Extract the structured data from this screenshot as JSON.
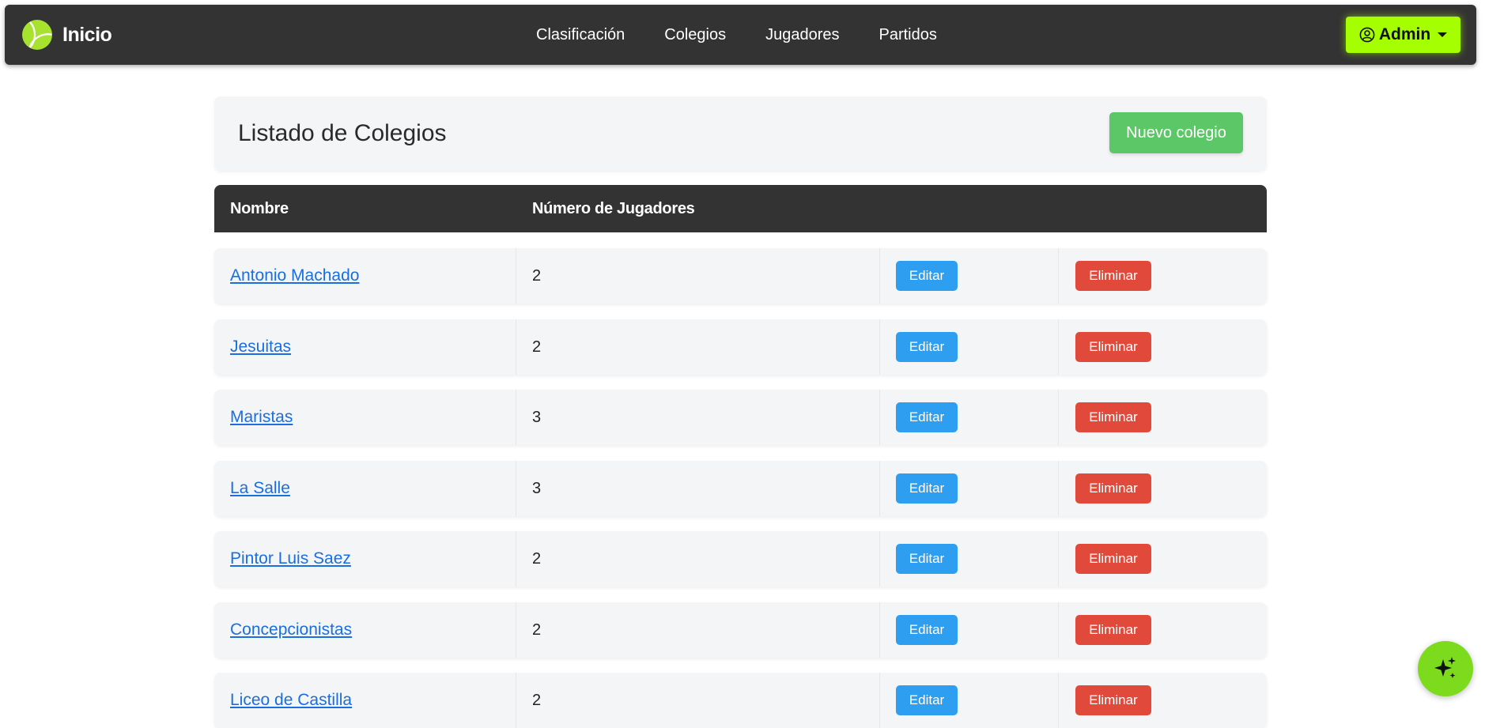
{
  "navbar": {
    "brand": "Inicio",
    "links": [
      "Clasificación",
      "Colegios",
      "Jugadores",
      "Partidos"
    ],
    "user_menu": {
      "label": "Admin",
      "icon": "user-circle-icon"
    }
  },
  "header": {
    "title": "Listado de Colegios",
    "new_button": "Nuevo colegio"
  },
  "table": {
    "columns": [
      "Nombre",
      "Número de Jugadores"
    ],
    "rows": [
      {
        "name": "Antonio Machado",
        "players": "2",
        "edit": "Editar",
        "delete": "Eliminar"
      },
      {
        "name": "Jesuitas",
        "players": "2",
        "edit": "Editar",
        "delete": "Eliminar"
      },
      {
        "name": "Maristas",
        "players": "3",
        "edit": "Editar",
        "delete": "Eliminar"
      },
      {
        "name": "La Salle",
        "players": "3",
        "edit": "Editar",
        "delete": "Eliminar"
      },
      {
        "name": "Pintor Luis Saez",
        "players": "2",
        "edit": "Editar",
        "delete": "Eliminar"
      },
      {
        "name": "Concepcionistas",
        "players": "2",
        "edit": "Editar",
        "delete": "Eliminar"
      },
      {
        "name": "Liceo de Castilla",
        "players": "2",
        "edit": "Editar",
        "delete": "Eliminar"
      }
    ]
  },
  "fab": {
    "icon": "sparkle-icon"
  },
  "colors": {
    "navbar_bg": "#333333",
    "accent": "#a6ff00",
    "success": "#5cc766",
    "edit": "#2e9ef0",
    "danger": "#e14a3b",
    "link": "#1a6fe0"
  }
}
